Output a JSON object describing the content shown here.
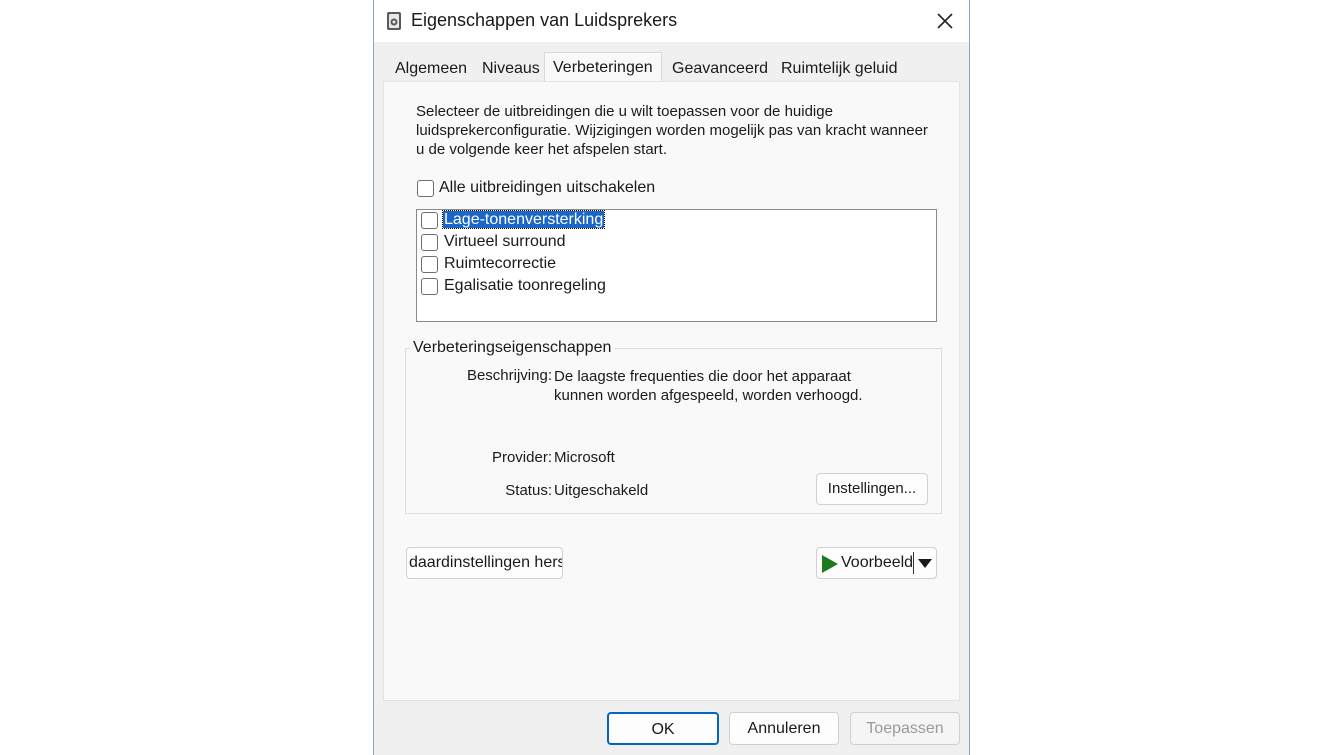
{
  "window": {
    "title": "Eigenschappen van Luidsprekers"
  },
  "tabs": [
    {
      "label": "Algemeen"
    },
    {
      "label": "Niveaus"
    },
    {
      "label": "Verbeteringen"
    },
    {
      "label": "Geavanceerd"
    },
    {
      "label": "Ruimtelijk geluid"
    }
  ],
  "intro_text": "Selecteer de uitbreidingen die u wilt toepassen voor de huidige luidsprekerconfiguratie. Wijzigingen worden mogelijk pas van kracht wanneer u de volgende keer het afspelen start.",
  "disable_all": {
    "label": "Alle uitbreidingen uitschakelen",
    "checked": false
  },
  "enhancements": [
    {
      "label": "Lage-tonenversterking",
      "checked": false,
      "selected": true
    },
    {
      "label": "Virtueel surround",
      "checked": false,
      "selected": false
    },
    {
      "label": "Ruimtecorrectie",
      "checked": false,
      "selected": false
    },
    {
      "label": "Egalisatie toonregeling",
      "checked": false,
      "selected": false
    }
  ],
  "properties": {
    "legend": "Verbeteringseigenschappen",
    "description_label": "Beschrijving:",
    "description_value": "De laagste frequenties die door het apparaat kunnen worden afgespeeld, worden verhoogd.",
    "provider_label": "Provider:",
    "provider_value": "Microsoft",
    "status_label": "Status:",
    "status_value": "Uitgeschakeld",
    "settings_button": "Instellingen..."
  },
  "restore_button": "daardinstellingen herst",
  "preview_button": "Voorbeeld",
  "footer": {
    "ok": "OK",
    "cancel": "Annuleren",
    "apply": "Toepassen"
  },
  "colors": {
    "selection": "#1a66c9",
    "play": "#1e7a1e",
    "ok_border": "#0067c0"
  }
}
